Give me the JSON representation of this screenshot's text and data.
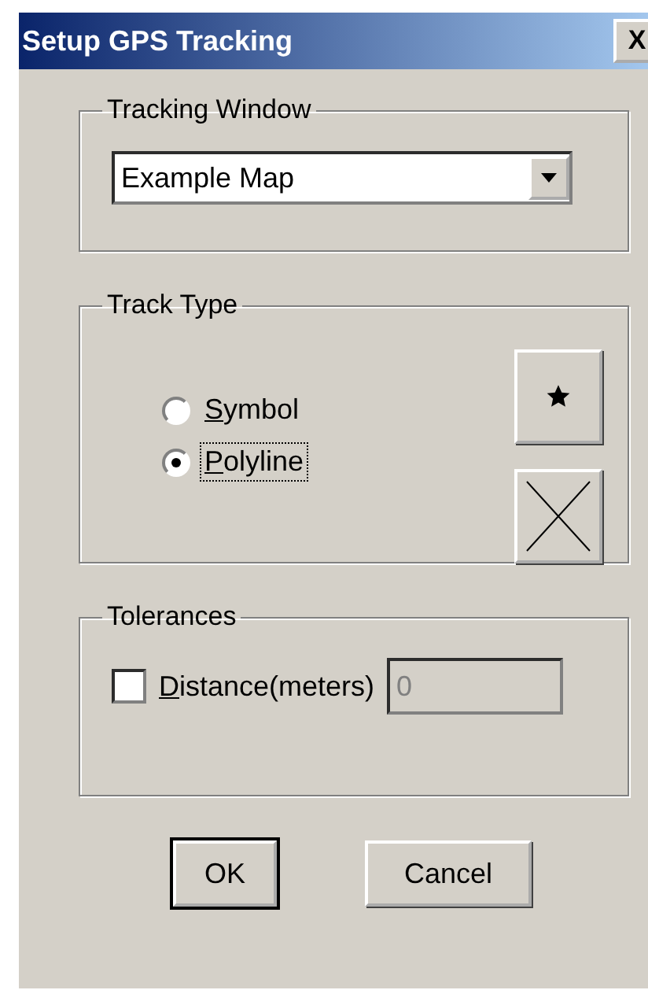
{
  "window": {
    "title": "Setup GPS Tracking",
    "close": "X"
  },
  "tracking_window": {
    "label": "Tracking Window",
    "map": {
      "value": "Example Map"
    }
  },
  "track_type": {
    "label": "Track Type",
    "options": [
      {
        "label": "Symbol",
        "selected": false,
        "focused": false,
        "mnemonic": true
      },
      {
        "label": "Polyline",
        "selected": true,
        "focused": true,
        "mnemonic": true
      }
    ],
    "style_buttons": [
      {
        "kind": "star"
      },
      {
        "kind": "cross"
      }
    ]
  },
  "tolerances": {
    "label": "Tolerances",
    "distance": {
      "label": "Distance(meters)",
      "checked": false,
      "mnemonic": true,
      "value": "0",
      "disabled": true
    }
  },
  "buttons": [
    {
      "label": "OK",
      "default": true
    },
    {
      "label": "Cancel",
      "default": false
    }
  ]
}
